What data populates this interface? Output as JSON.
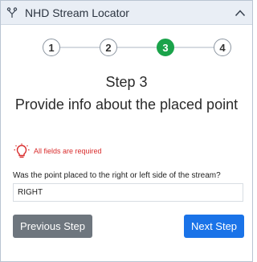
{
  "header": {
    "title": "NHD Stream Locator",
    "icon": "branch-icon",
    "collapse_icon": "chevron-up-icon"
  },
  "stepper": {
    "steps": [
      "1",
      "2",
      "3",
      "4"
    ],
    "active_step": 3,
    "active_color": "#1aa34a"
  },
  "content": {
    "step_label": "Step 3",
    "heading": "Provide info about the placed point",
    "required_note": "All fields are required",
    "question": "Was the point placed to the right or left side of the stream?",
    "answer_value": "RIGHT"
  },
  "buttons": {
    "previous_label": "Previous Step",
    "next_label": "Next Step"
  },
  "colors": {
    "primary": "#1a73e8",
    "secondary": "#6e767e",
    "error": "#d92c2c"
  }
}
